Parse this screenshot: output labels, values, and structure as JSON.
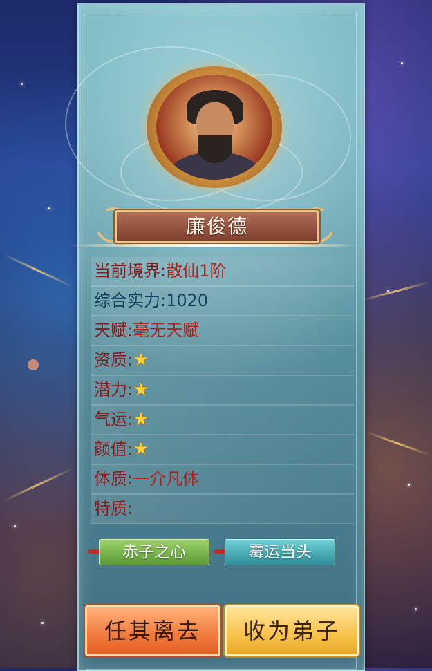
{
  "character": {
    "name": "廉俊德"
  },
  "stats": [
    {
      "label": "当前境界:",
      "value": "散仙1阶",
      "label_color": "red",
      "value_type": "text-red"
    },
    {
      "label": "综合实力:",
      "value": "1020",
      "label_color": "blue",
      "value_type": "text-blue"
    },
    {
      "label": "天赋:",
      "value": "毫无天赋",
      "label_color": "red",
      "value_type": "text-red"
    },
    {
      "label": "资质:",
      "value": "★",
      "label_color": "red",
      "value_type": "stars",
      "stars": 1
    },
    {
      "label": "潜力:",
      "value": "★",
      "label_color": "red",
      "value_type": "stars",
      "stars": 1
    },
    {
      "label": "气运:",
      "value": "★",
      "label_color": "red",
      "value_type": "stars",
      "stars": 1
    },
    {
      "label": "颜值:",
      "value": "★",
      "label_color": "red",
      "value_type": "stars",
      "stars": 1
    },
    {
      "label": "体质:",
      "value": "一介凡体",
      "label_color": "red",
      "value_type": "text-red"
    },
    {
      "label": "特质:",
      "value": "",
      "label_color": "red",
      "value_type": "text-red"
    }
  ],
  "traits": [
    {
      "label": "赤子之心",
      "color": "#7bb84c"
    },
    {
      "label": "霉运当头",
      "color": "#3fa8b4"
    }
  ],
  "buttons": {
    "leave": "任其离去",
    "accept": "收为弟子"
  },
  "colors": {
    "label_red": "#8a1c1c",
    "value_red": "#b0261e",
    "label_blue": "#15435e",
    "star": "#ffd23a",
    "name_plate": "#9a5441"
  }
}
